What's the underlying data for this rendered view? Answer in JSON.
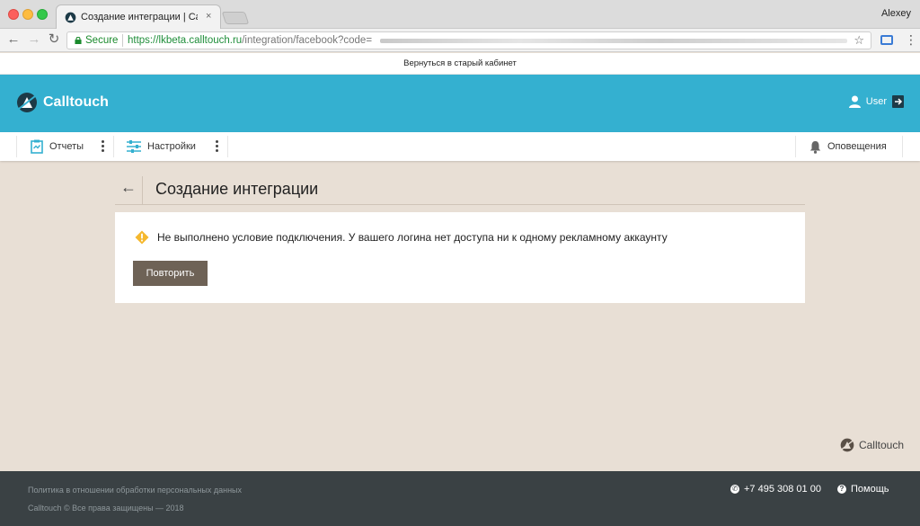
{
  "browser": {
    "tab_title": "Создание интеграции | Calltouch",
    "tab_close": "×",
    "window_user": "Alexey",
    "secure_label": "Secure",
    "url_host": "https://lkbeta.calltouch.ru",
    "url_path": "/integration/facebook?code=",
    "icons": [
      "back-arrow-icon",
      "forward-arrow-icon",
      "reload-icon",
      "lock-icon",
      "star-icon",
      "cast-icon",
      "menu-icon"
    ]
  },
  "banner": {
    "old_cabinet_link": "Вернуться в старый кабинет"
  },
  "header": {
    "logo_text": "Calltouch",
    "user_label": "User",
    "brand_color": "#34b0d0"
  },
  "nav": {
    "reports": "Отчеты",
    "settings": "Настройки",
    "notifications": "Оповещения"
  },
  "page": {
    "back": "←",
    "title": "Создание интеграции"
  },
  "alert": {
    "message": "Не выполнено условие подключения. У вашего логина нет доступа ни к одному рекламному аккаунту",
    "retry_label": "Повторить",
    "warning_color": "#f5b82e",
    "button_color": "#6e6256"
  },
  "bottom_logo": "Calltouch",
  "footer": {
    "policy": "Политика в отношении обработки персональных данных",
    "copyright": "Calltouch © Все права защищены — 2018",
    "phone": "+7 495 308 01 00",
    "help": "Помощь"
  }
}
